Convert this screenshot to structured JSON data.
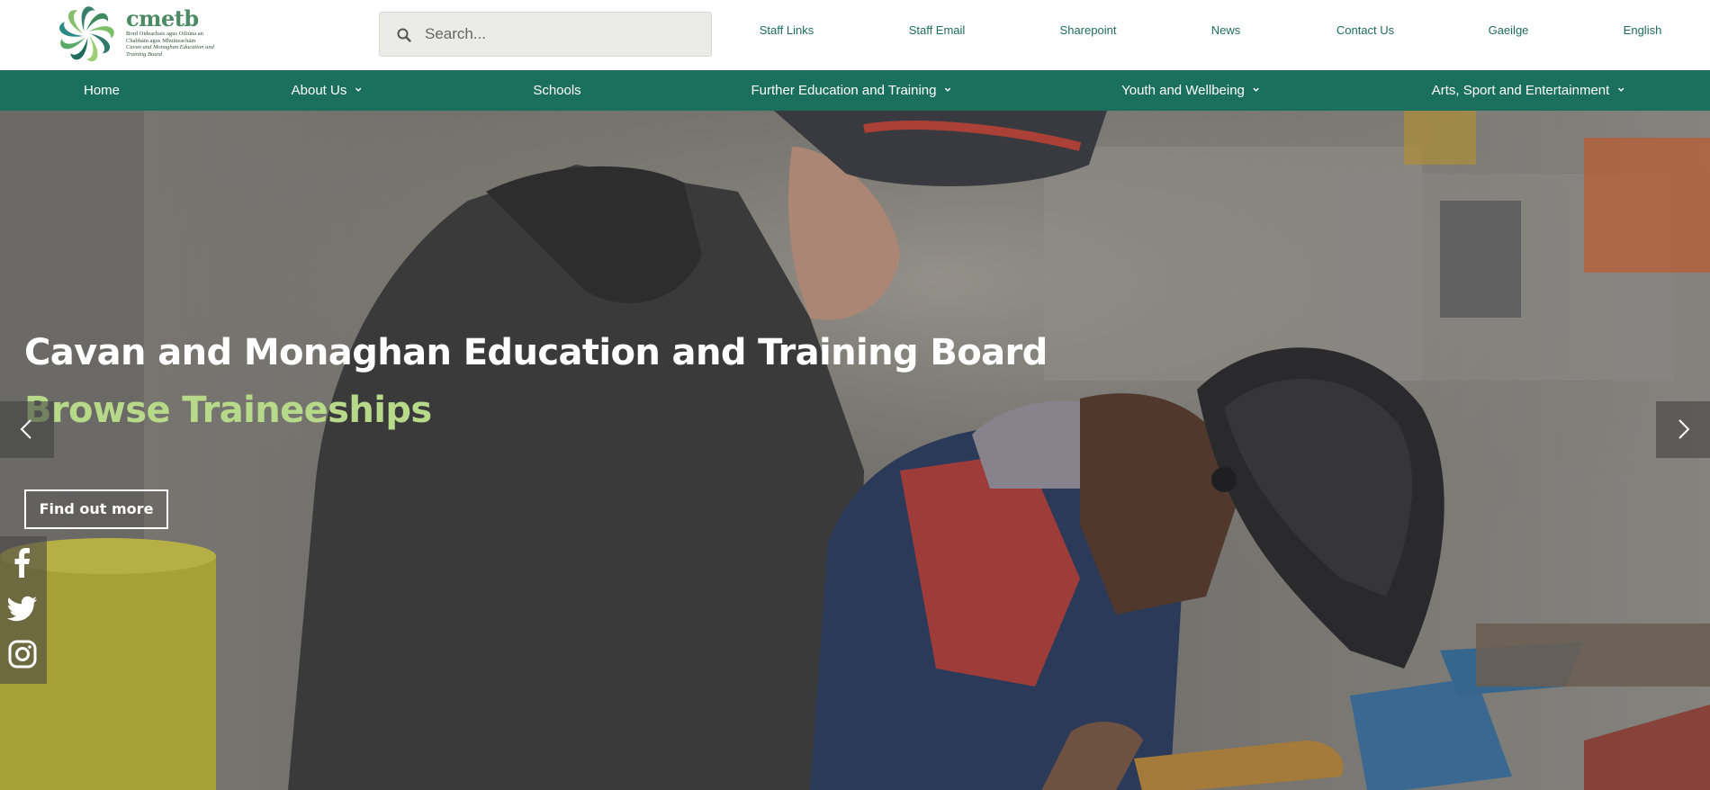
{
  "logo": {
    "name": "cmetb",
    "sub_irish": "Bord Oideachais agus Oiliúna an Chabháin agus Mhuineacháin",
    "sub_english": "Cavan and Monaghan Education and Training Board"
  },
  "search": {
    "placeholder": "Search..."
  },
  "top_links": [
    {
      "label": "Staff Links"
    },
    {
      "label": "Staff Email"
    },
    {
      "label": "Sharepoint"
    },
    {
      "label": "News"
    },
    {
      "label": "Contact Us"
    },
    {
      "label": "Gaeilge"
    },
    {
      "label": "English"
    }
  ],
  "nav": [
    {
      "label": "Home",
      "has_dropdown": false
    },
    {
      "label": "About Us",
      "has_dropdown": true
    },
    {
      "label": "Schools",
      "has_dropdown": false
    },
    {
      "label": "Further Education and Training",
      "has_dropdown": true
    },
    {
      "label": "Youth and Wellbeing",
      "has_dropdown": true
    },
    {
      "label": "Arts, Sport and Entertainment",
      "has_dropdown": true
    }
  ],
  "hero": {
    "title": "Cavan and Monaghan Education and Training Board",
    "subtitle": "Browse Traineeships",
    "button_label": "Find out more"
  },
  "social": [
    {
      "icon": "facebook-icon"
    },
    {
      "icon": "twitter-icon"
    },
    {
      "icon": "instagram-icon"
    }
  ],
  "colors": {
    "nav_bg": "#1b6f5d",
    "link": "#1e6b5c",
    "subtitle": "#b7d98a",
    "search_bg": "#ebebe7"
  }
}
